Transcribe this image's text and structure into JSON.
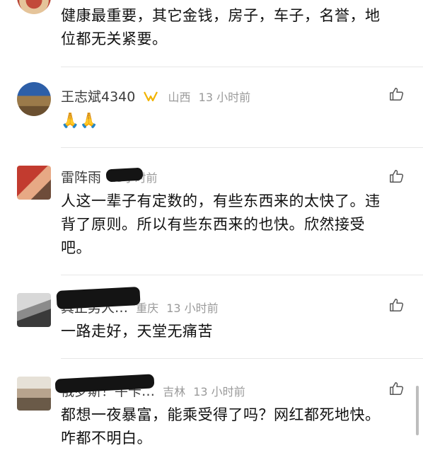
{
  "comments": [
    {
      "username": "",
      "location": "",
      "time": "",
      "text": "健康最重要，其它金钱，房子，车子，名誉，地位都无关紧要。"
    },
    {
      "username": "王志斌4340",
      "location": "山西",
      "time": "13 小时前",
      "text": "🙏🙏"
    },
    {
      "username": "雷阵雨",
      "location": "",
      "time": "13小时前",
      "text": "人这一辈子有定数的，有些东西来的太快了。违背了原则。所以有些东西来的也快。欣然接受吧。"
    },
    {
      "username": "真正男人…",
      "location": "重庆",
      "time": "13 小时前",
      "text": "一路走好，天堂无痛苦"
    },
    {
      "username": "俄罗斯！牛卡…",
      "location": "吉林",
      "time": "13 小时前",
      "text": "都想一夜暴富，能乘受得了吗？网红都死地快。咋都不明白。"
    }
  ],
  "icons": {
    "like": "thumbs-up-icon",
    "badge": "vip-badge-icon"
  },
  "colors": {
    "meta_text": "#9a9a9a",
    "username": "#3d3d3d",
    "badge": "#f2b300"
  }
}
